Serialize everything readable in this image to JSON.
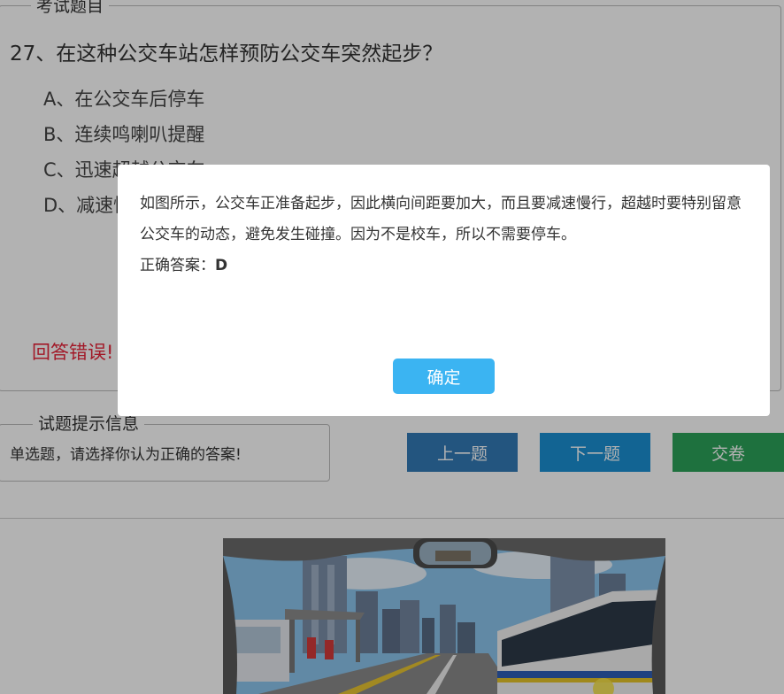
{
  "question": {
    "legend": "考试题目",
    "title": "27、在这种公交车站怎样预防公交车突然起步？",
    "options": [
      "A、在公交车后停车",
      "B、连续鸣喇叭提醒",
      "C、迅速超越公交车",
      "D、减速慢行，注意观察动态"
    ],
    "feedback": "回答错误!"
  },
  "hint": {
    "legend": "试题提示信息",
    "text": "单选题，请选择你认为正确的答案!"
  },
  "buttons": {
    "prev": "上一题",
    "next": "下一题",
    "submit": "交卷"
  },
  "dialog": {
    "explanation": "如图所示，公交车正准备起步，因此横向间距要加大，而且要减速慢行，超越时要特别留意公交车的动态，避免发生碰撞。因为不是校车，所以不需要停车。",
    "answer_label": "正确答案：",
    "answer_value": "D",
    "ok_label": "确定"
  },
  "colors": {
    "prev_button": "#337ab7",
    "next_button": "#1b90d3",
    "submit_button": "#2ca35a",
    "ok_button": "#3bb4f2",
    "feedback": "#e8243a"
  }
}
